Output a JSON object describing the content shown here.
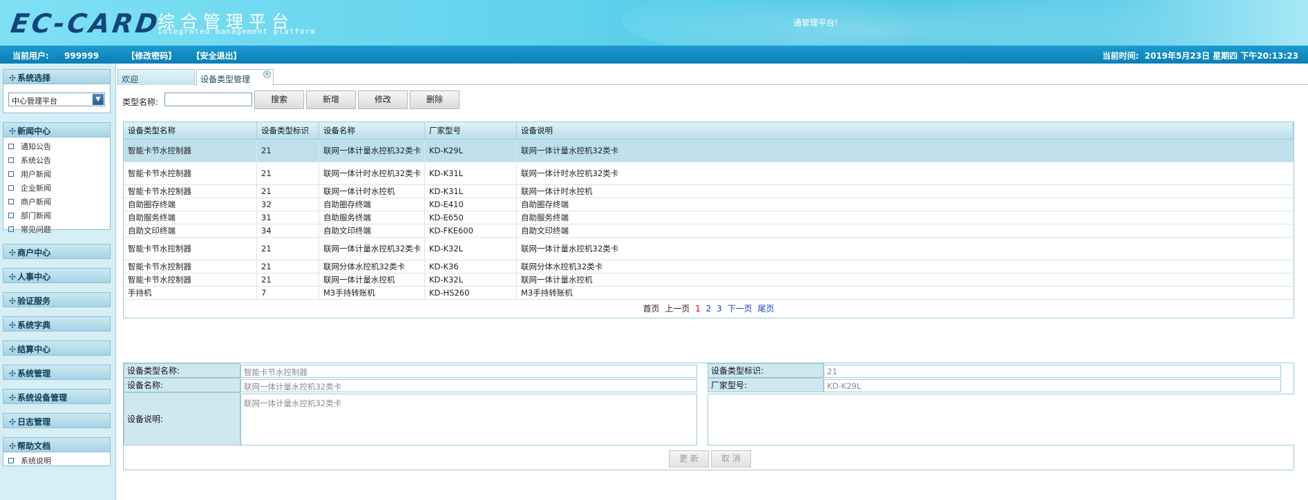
{
  "header": {
    "logo_text": "EC-CARD",
    "title": "综合管理平台",
    "subtitle": "Integrated management platform",
    "welcome": "通管理平台!"
  },
  "infobar": {
    "user_label": "当前用户:",
    "user_value": "999999",
    "change_password": "【修改密码】",
    "logout": "【安全退出】",
    "time_label": "当前时间:",
    "time_value": "2019年5月23日 星期四 下午20:13:23"
  },
  "sidebar": {
    "system_select": {
      "title": "系统选择",
      "selected": "中心管理平台"
    },
    "news": {
      "title": "新闻中心",
      "items": [
        "通知公告",
        "系统公告",
        "用户新闻",
        "企业新闻",
        "商户新闻",
        "部门新闻",
        "常见问题"
      ]
    },
    "sections": [
      "商户中心",
      "人事中心",
      "验证服务",
      "系统字典",
      "结算中心",
      "系统管理",
      "系统设备管理",
      "日志管理"
    ],
    "help": {
      "title": "帮助文档",
      "items": [
        "系统说明"
      ]
    }
  },
  "tabs": [
    "欢迎",
    "设备类型管理"
  ],
  "toolbar": {
    "label": "类型名称:",
    "input_value": "",
    "search": "搜索",
    "add": "新增",
    "edit": "修改",
    "delete": "删除"
  },
  "table": {
    "columns": [
      "设备类型名称",
      "设备类型标识",
      "设备名称",
      "厂家型号",
      "设备说明"
    ],
    "rows": [
      [
        "智能卡节水控制器",
        "21",
        "联网一体计量水控机32类卡",
        "KD-K29L",
        "联网一体计量水控机32类卡"
      ],
      [
        "智能卡节水控制器",
        "21",
        "联网一体计时水控机32类卡",
        "KD-K31L",
        "联网一体计时水控机32类卡"
      ],
      [
        "智能卡节水控制器",
        "21",
        "联网一体计时水控机",
        "KD-K31L",
        "联网一体计时水控机"
      ],
      [
        "自助圈存终端",
        "32",
        "自助圈存终端",
        "KD-E410",
        "自助圈存终端"
      ],
      [
        "自助服务终端",
        "31",
        "自助服务终端",
        "KD-E650",
        "自助服务终端"
      ],
      [
        "自助文印终端",
        "34",
        "自助文印终端",
        "KD-FKE600",
        "自助文印终端"
      ],
      [
        "智能卡节水控制器",
        "21",
        "联网一体计量水控机32类卡",
        "KD-K32L",
        "联网一体计量水控机32类卡"
      ],
      [
        "智能卡节水控制器",
        "21",
        "联网分体水控机32类卡",
        "KD-K36",
        "联网分体水控机32类卡"
      ],
      [
        "智能卡节水控制器",
        "21",
        "联网一体计量水控机",
        "KD-K32L",
        "联网一体计量水控机"
      ],
      [
        "手持机",
        "7",
        "M3手持转账机",
        "KD-HS260",
        "M3手持转账机"
      ]
    ],
    "selected_row": 0
  },
  "pager": {
    "first": "首页",
    "prev": "上一页",
    "pages": [
      "1",
      "2",
      "3"
    ],
    "current": "1",
    "next": "下一页",
    "last": "尾页"
  },
  "form": {
    "type_name_label": "设备类型名称:",
    "type_name_value": "智能卡节水控制器",
    "type_id_label": "设备类型标识:",
    "type_id_value": "21",
    "device_name_label": "设备名称:",
    "device_name_value": "联网一体计量水控机32类卡",
    "model_label": "厂家型号:",
    "model_value": "KD-K29L",
    "desc_label": "设备说明:",
    "desc_value": "联网一体计量水控机32类卡",
    "update": "更 新",
    "cancel": "取 消"
  }
}
